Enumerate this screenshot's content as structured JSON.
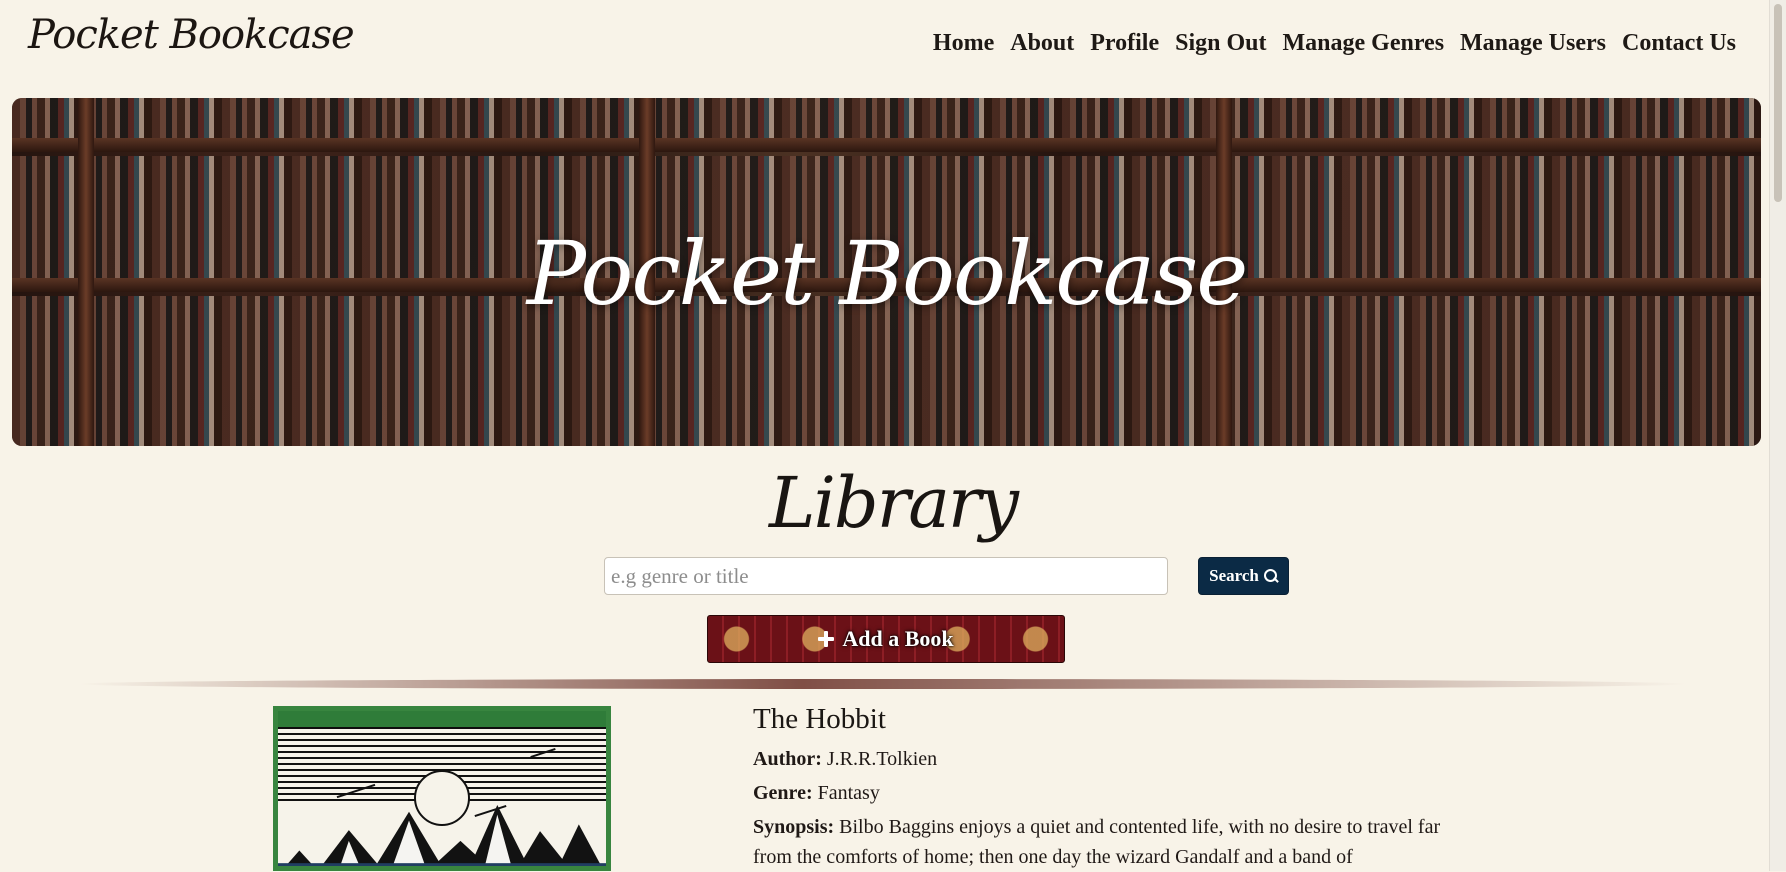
{
  "navbar": {
    "brand": "Pocket Bookcase",
    "links": [
      "Home",
      "About",
      "Profile",
      "Sign Out",
      "Manage Genres",
      "Manage Users",
      "Contact Us"
    ]
  },
  "hero": {
    "title": "Pocket Bookcase"
  },
  "library": {
    "title": "Library",
    "search_placeholder": "e.g genre or title",
    "search_label": "Search",
    "add_book_label": "Add a Book"
  },
  "book": {
    "title": "The Hobbit",
    "author_label": "Author:",
    "author": "J.R.R.Tolkien",
    "genre_label": "Genre:",
    "genre": "Fantasy",
    "synopsis_label": "Synopsis:",
    "synopsis": "Bilbo Baggins enjoys a quiet and contented life, with no desire to travel far from the comforts of home; then one day the wizard Gandalf and a band of"
  },
  "icons": {
    "search": "search-icon",
    "plus": "plus-icon"
  },
  "colors": {
    "background": "#f8f3e8",
    "search_button": "#0b2a45",
    "book_cover_green": "#38853f",
    "add_button_red": "#6b1117"
  }
}
